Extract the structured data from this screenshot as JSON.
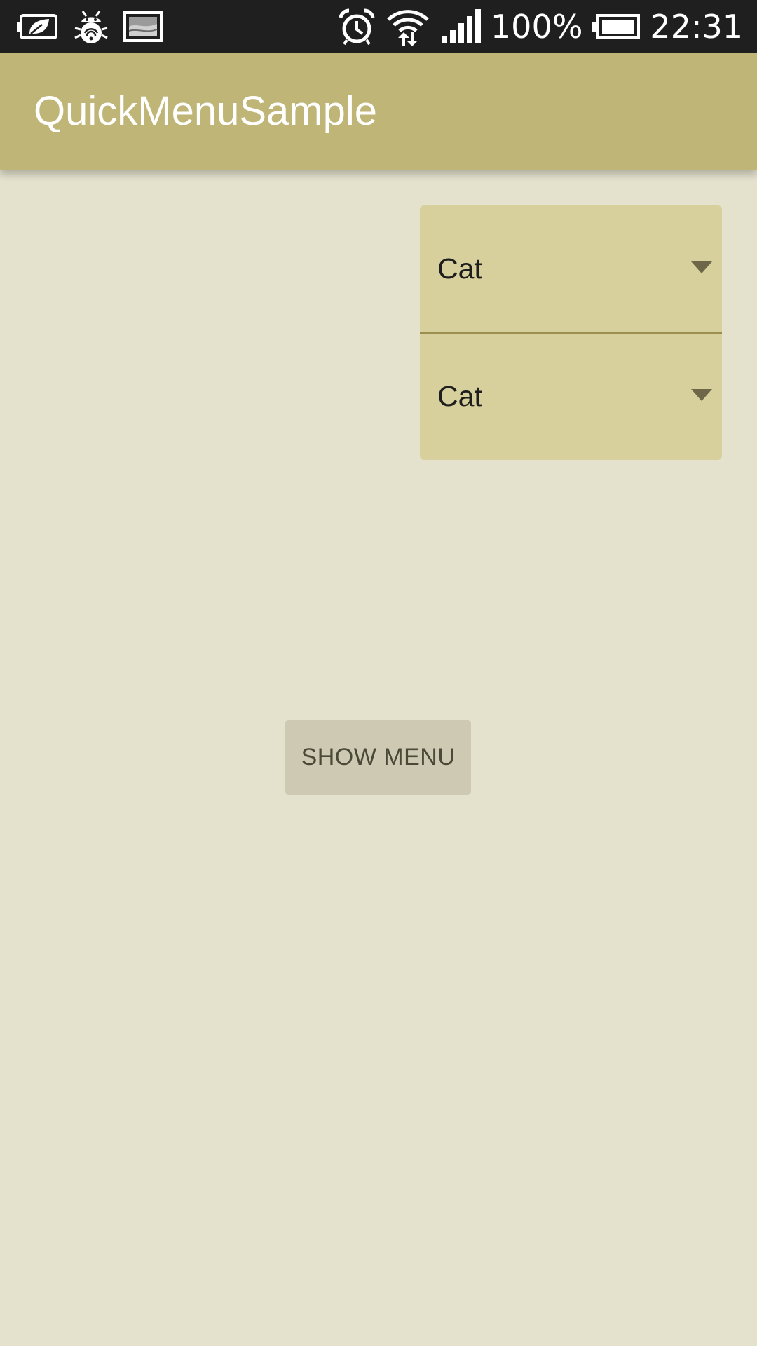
{
  "status_bar": {
    "left_icons": [
      "battery-saver-icon",
      "debug-bug-icon",
      "image-notification-icon"
    ],
    "right_icons": [
      "alarm-clock-icon",
      "wifi-data-icon",
      "cell-signal-icon",
      "battery-icon"
    ],
    "battery_percent": "100%",
    "time": "22:31"
  },
  "app_bar": {
    "title": "QuickMenuSample"
  },
  "spinners": [
    {
      "selected": "Cat",
      "icon": "dropdown-arrow-icon"
    },
    {
      "selected": "Cat",
      "icon": "dropdown-arrow-icon"
    }
  ],
  "actions": {
    "show_menu_label": "SHOW MENU"
  },
  "colors": {
    "status_bar": "#1f1f1f",
    "app_bar": "#bfb577",
    "background": "#e4e1cd",
    "spinner_bg": "#d8d09c",
    "button_bg": "#cdc9b3"
  }
}
